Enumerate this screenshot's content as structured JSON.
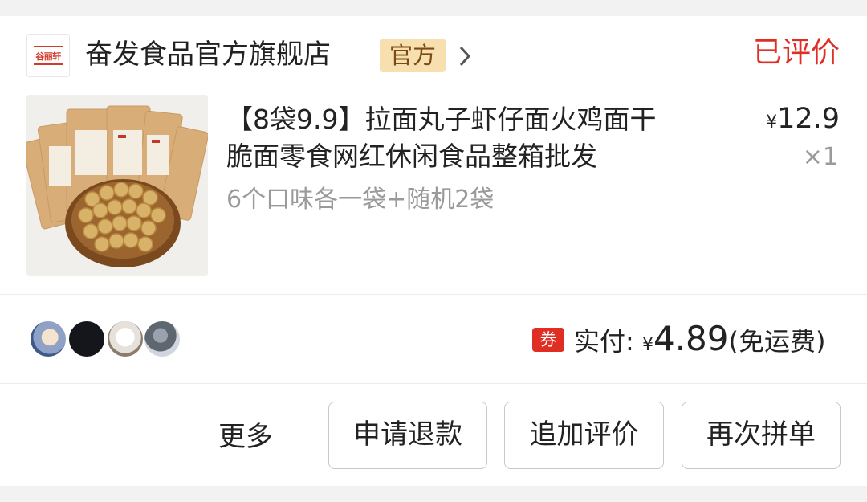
{
  "store": {
    "logo_text": "谷丽轩",
    "name": "奋发食品官方旗舰店",
    "badge": "官方",
    "review_status": "已评价"
  },
  "product": {
    "title_line1": "【8袋9.9】拉面丸子虾仔面火鸡面干",
    "title_line2": "脆面零食网红休闲食品整箱批发",
    "variant": "6个口味各一袋+随机2袋",
    "price_symbol": "¥",
    "price": "12.9",
    "quantity": "×1"
  },
  "payment": {
    "coupon_label": "券",
    "paid_label": "实付: ",
    "currency": "¥",
    "amount": "4.89",
    "shipping_note": "(免运费)"
  },
  "actions": {
    "more": "更多",
    "refund": "申请退款",
    "add_review": "追加评价",
    "reorder": "再次拼单"
  },
  "colors": {
    "accent_red": "#e02e24",
    "badge_bg": "#f7dfb0"
  }
}
